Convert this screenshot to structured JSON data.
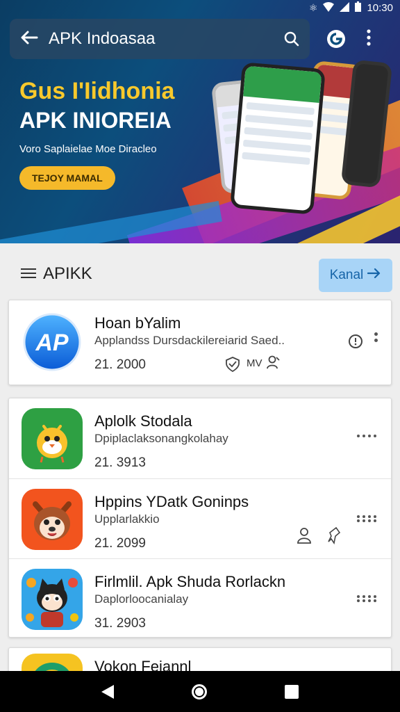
{
  "status_bar": {
    "time": "10:30"
  },
  "search_bar": {
    "title": "APK Indoasaa"
  },
  "hero": {
    "title_line1": "Gus I'Iidhonia",
    "title_line2": "APK INIOREIA",
    "subtitle": "Voro Saplaielae Moe Diracleo",
    "button_label": "TEJOY MAMAL",
    "colors": {
      "accent_yellow": "#f8c92c",
      "background": "#0c4e7c"
    }
  },
  "section": {
    "title": "APIKK",
    "action_label": "Kanal"
  },
  "apps_featured": [
    {
      "name": "Hoan bYalim",
      "description": "Applandss Dursdackilereiarid Saed..",
      "count": "21. 2000",
      "badge": "MV",
      "icon": "apk-logo-icon"
    }
  ],
  "apps_list": [
    {
      "name": "Aplolk Stodala",
      "description": "Dpiplaclaksonangkolahay",
      "count": "21. 3913",
      "icon": "android-bird-icon"
    },
    {
      "name": "Hppins YDatk Goninps",
      "description": "Upplarlakkio",
      "count": "21. 2099",
      "icon": "fox-cartoon-icon"
    },
    {
      "name": "Firlmlil. Apk Shuda Rorlackn",
      "description": "Daplorloocanialay",
      "count": "31. 2903",
      "icon": "cat-cartoon-icon"
    }
  ],
  "apps_partial": [
    {
      "name": "Vokon Fejannl",
      "icon": "green-circle-icon"
    }
  ]
}
